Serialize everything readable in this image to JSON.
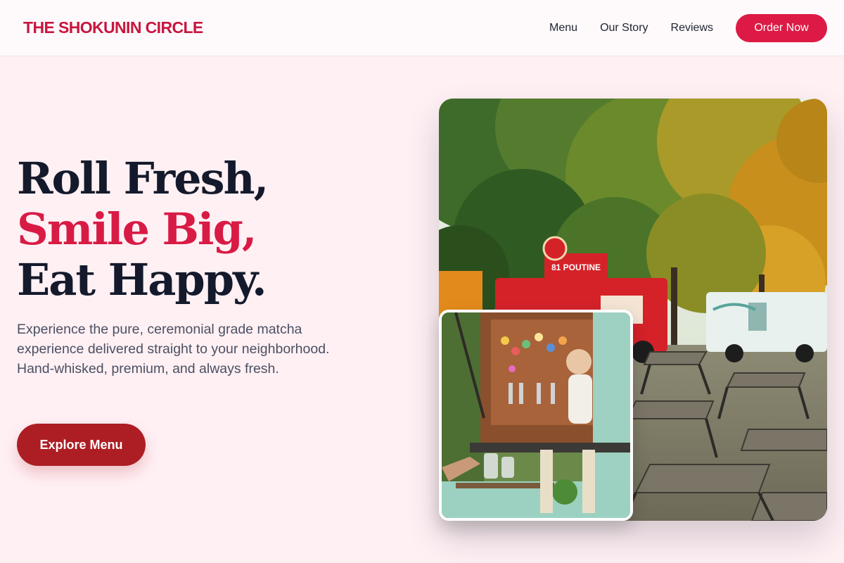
{
  "brand": {
    "name": "THE SHOKUNIN CIRCLE"
  },
  "nav": {
    "links": [
      "Menu",
      "Our Story",
      "Reviews"
    ],
    "cta": "Order Now"
  },
  "hero": {
    "headline": [
      "Roll Fresh,",
      "Smile Big,",
      "Eat Happy."
    ],
    "description": "Experience the pure, ceremonial grade matcha experience delivered straight to your neighborhood. Hand-whisked, premium, and always fresh.",
    "cta": "Explore Menu"
  },
  "images": {
    "main": {
      "signage": "81 POUTINE"
    },
    "inset": {}
  },
  "colors": {
    "brand": "#c8163f",
    "accent": "#d81b45",
    "cta_primary": "#dc1a45",
    "cta_secondary": "#ad1e24",
    "background": "#fff0f4",
    "text_dark": "#141a2b"
  }
}
